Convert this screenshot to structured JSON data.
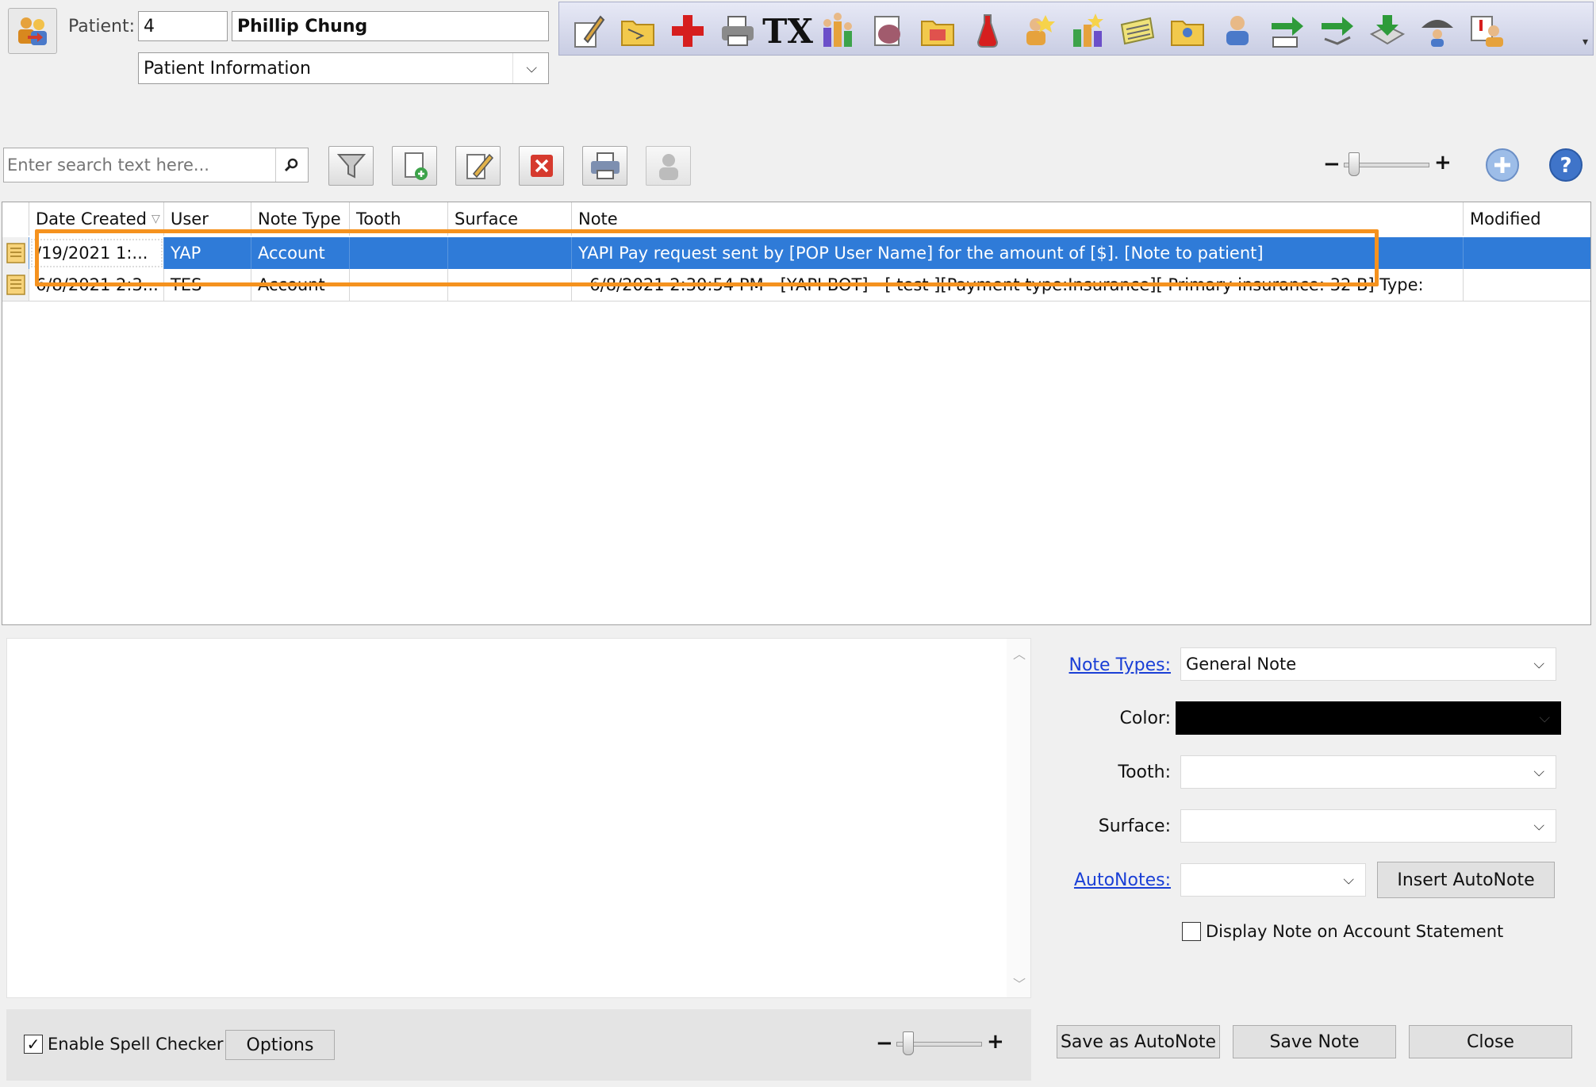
{
  "patient": {
    "label": "Patient:",
    "id": "4",
    "name": "Phillip Chung",
    "view_selected": "Patient Information"
  },
  "toolbar_icons": [
    "note-edit-icon",
    "folder-icon",
    "medical-cross-icon",
    "printer-icon",
    "rx-icon",
    "family-icon",
    "brain-icon",
    "folder-note-icon",
    "medicine-bottle-icon",
    "user-alert-icon",
    "family-alert-icon",
    "ledger-icon",
    "folder-user-icon",
    "patient-user-icon",
    "transfer-out-icon",
    "transfer-in-icon",
    "download-tray-icon",
    "user-umbrella-icon",
    "user-alert-card-icon"
  ],
  "toolbar_text": {
    "rx_icon": "TX"
  },
  "search": {
    "placeholder": "Enter search text here..."
  },
  "grid": {
    "columns": {
      "date_created": "Date Created",
      "user": "User",
      "note_type": "Note Type",
      "tooth": "Tooth",
      "surface": "Surface",
      "note": "Note",
      "modified": "Modified"
    },
    "rows": [
      {
        "date_created": "/19/2021 1:...",
        "user": "YAP",
        "note_type": "Account",
        "tooth": "",
        "surface": "",
        "note": "YAPI Pay request sent by [POP User Name] for the amount of [$]. [Note to patient]",
        "modified": "",
        "selected": true
      },
      {
        "date_created": "6/8/2021 2:3...",
        "user": "TES",
        "note_type": "Account",
        "tooth": "",
        "surface": "",
        "note": "- 6/8/2021 2:30:54 PM - [YAPI BOT] - [ test ][Payment type:Insurance][ Primary insurance: 32 B] Type:",
        "modified": "",
        "selected": false
      }
    ]
  },
  "form": {
    "note_types_label": "Note Types:",
    "note_types_value": "General Note",
    "color_label": "Color:",
    "color_value": "#000000",
    "tooth_label": "Tooth:",
    "tooth_value": "",
    "surface_label": "Surface:",
    "surface_value": "",
    "autonotes_label": "AutoNotes:",
    "autonotes_value": "",
    "insert_autonote": "Insert AutoNote",
    "display_on_statement": "Display Note on Account Statement",
    "display_on_statement_checked": false
  },
  "editor": {
    "enable_spell_checker": "Enable Spell Checker",
    "spell_checker_checked": true,
    "options": "Options"
  },
  "buttons": {
    "save_as_autonote": "Save as AutoNote",
    "save_note": "Save Note",
    "close": "Close"
  },
  "zoom_symbols": {
    "minus": "−",
    "plus": "+"
  },
  "colors": {
    "selection": "#2f7bd8",
    "highlight_box": "#f5921e",
    "link": "#1a3fd6"
  }
}
